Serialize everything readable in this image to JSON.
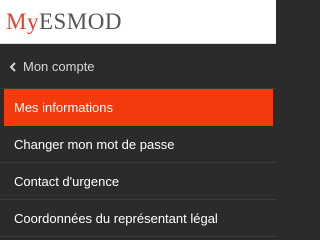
{
  "header": {
    "logo_my": "My",
    "logo_brand": "ESMOD"
  },
  "menu": {
    "back_label": "Mon compte",
    "items": [
      {
        "label": "Mes informations",
        "active": true
      },
      {
        "label": "Changer mon mot de passe",
        "active": false
      },
      {
        "label": "Contact d'urgence",
        "active": false
      },
      {
        "label": "Coordonnées du représentant légal",
        "active": false
      }
    ]
  },
  "colors": {
    "accent": "#f23a0c",
    "menu_bg": "#2b2b2b",
    "logo_my": "#e8402a"
  },
  "icons": {
    "back": "chevron-left-icon"
  }
}
